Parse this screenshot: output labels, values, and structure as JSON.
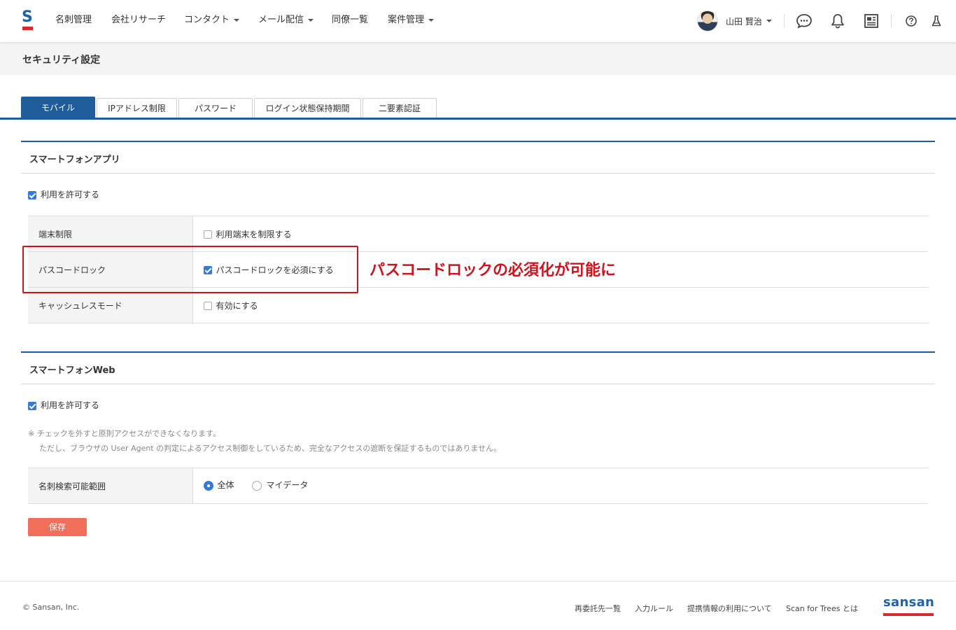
{
  "header": {
    "logo_letter": "S",
    "nav": [
      {
        "label": "名刺管理",
        "dropdown": false
      },
      {
        "label": "会社リサーチ",
        "dropdown": false
      },
      {
        "label": "コンタクト",
        "dropdown": true
      },
      {
        "label": "メール配信",
        "dropdown": true
      },
      {
        "label": "同僚一覧",
        "dropdown": false
      },
      {
        "label": "案件管理",
        "dropdown": true
      }
    ],
    "user_name": "山田 賢治",
    "icons": [
      "chat-icon",
      "bell-icon",
      "newspaper-icon",
      "help-icon",
      "flask-icon"
    ]
  },
  "page": {
    "title": "セキュリティ設定"
  },
  "tabs": [
    {
      "label": "モバイル",
      "active": true
    },
    {
      "label": "IPアドレス制限",
      "active": false
    },
    {
      "label": "パスワード",
      "active": false
    },
    {
      "label": "ログイン状態保持期間",
      "active": false
    },
    {
      "label": "二要素認証",
      "active": false
    }
  ],
  "app_section": {
    "title": "スマートフォンアプリ",
    "allow_label": "利用を許可する",
    "allow_checked": true,
    "rows": [
      {
        "label": "端末制限",
        "option": "利用端末を制限する",
        "checked": false
      },
      {
        "label": "パスコードロック",
        "option": "パスコードロックを必須にする",
        "checked": true
      },
      {
        "label": "キャッシュレスモード",
        "option": "有効にする",
        "checked": false
      }
    ]
  },
  "annotation": {
    "text": "パスコードロックの必須化が可能に",
    "color": "#d0121b"
  },
  "web_section": {
    "title": "スマートフォンWeb",
    "allow_label": "利用を許可する",
    "allow_checked": true,
    "note_line1": "※ チェックを外すと原則アクセスができなくなります。",
    "note_line2": "ただし、ブラウザの User Agent の判定によるアクセス制御をしているため、完全なアクセスの遮断を保証するものではありません。",
    "search_scope": {
      "label": "名刺検索可能範囲",
      "options": [
        "全体",
        "マイデータ"
      ],
      "selected": "全体"
    }
  },
  "save_label": "保存",
  "footer": {
    "copyright": "© Sansan, Inc.",
    "links": [
      "再委託先一覧",
      "入力ルール",
      "提携情報の利用について",
      "Scan for Trees とは"
    ],
    "brand": "sansan"
  },
  "colors": {
    "brand_blue": "#1e5c9b",
    "brand_red": "#d9282f",
    "save_button": "#f06e5a",
    "checkbox": "#3679d8"
  }
}
